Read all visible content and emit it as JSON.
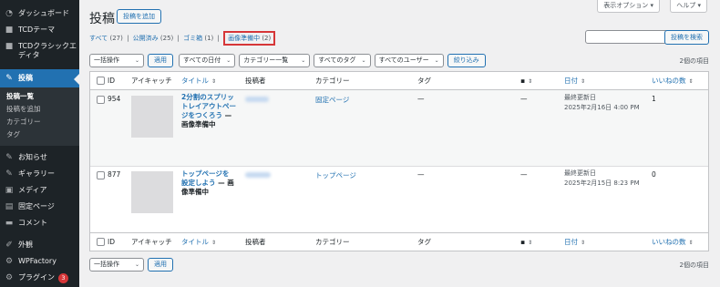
{
  "sidebar": {
    "items": [
      {
        "label": "ダッシュボード",
        "icon": "dashboard-icon"
      },
      {
        "label": "TCDテーマ",
        "icon": "tcd-icon"
      },
      {
        "label": "TCDクラシックエディタ",
        "icon": "tcd-icon"
      },
      {
        "label": "投稿",
        "icon": "pin-icon"
      }
    ],
    "submenu": [
      "投稿一覧",
      "投稿を追加",
      "カテゴリー",
      "タグ"
    ],
    "items2": [
      {
        "label": "お知らせ",
        "icon": "pin-icon"
      },
      {
        "label": "ギャラリー",
        "icon": "pin-icon"
      },
      {
        "label": "メディア",
        "icon": "media-icon"
      },
      {
        "label": "固定ページ",
        "icon": "page-icon"
      },
      {
        "label": "コメント",
        "icon": "comment-icon"
      },
      {
        "label": "外観",
        "icon": "brush-icon"
      },
      {
        "label": "WPFactory",
        "icon": "plugin-icon"
      },
      {
        "label": "プラグイン",
        "icon": "plugin-icon",
        "badge": "3"
      }
    ]
  },
  "header": {
    "title": "投稿",
    "add_new": "投稿を追加",
    "screen_options": "表示オプション ▾",
    "help": "ヘルプ ▾"
  },
  "filters": {
    "all": "すべて",
    "all_count": "(27)",
    "published": "公開済み",
    "published_count": "(25)",
    "trash": "ゴミ箱",
    "trash_count": "(1)",
    "pending": "画像準備中",
    "pending_count": "(2)",
    "sep": "|"
  },
  "search": {
    "button": "投稿を検索",
    "value": ""
  },
  "tablenav": {
    "bulk": "一括操作",
    "apply": "適用",
    "dates": "すべての日付",
    "categories": "カテゴリー一覧",
    "tags": "すべてのタグ",
    "users": "すべてのユーザー",
    "filter": "絞り込み",
    "count": "2個の項目"
  },
  "columns": {
    "id": "ID",
    "thumb": "アイキャッチ",
    "title": "タイトル",
    "author": "投稿者",
    "category": "カテゴリー",
    "tags": "タグ",
    "date": "日付",
    "likes": "いいねの数"
  },
  "rows": [
    {
      "id": "954",
      "title": "2分割のスプリットレイアウトページをつくろう",
      "state": "— 画像準備中",
      "category": "固定ページ",
      "tags": "—",
      "comments": "—",
      "date_label": "最終更新日",
      "date": "2025年2月16日 4:00 PM",
      "likes": "1"
    },
    {
      "id": "877",
      "title": "トップページを設定しよう",
      "state": "— 画像準備中",
      "category": "トップページ",
      "tags": "—",
      "comments": "—",
      "date_label": "最終更新日",
      "date": "2025年2月15日 8:23 PM",
      "likes": "0"
    }
  ],
  "colors": {
    "accent": "#2271b1",
    "sidebar": "#1d2327",
    "highlight": "#d63638"
  }
}
